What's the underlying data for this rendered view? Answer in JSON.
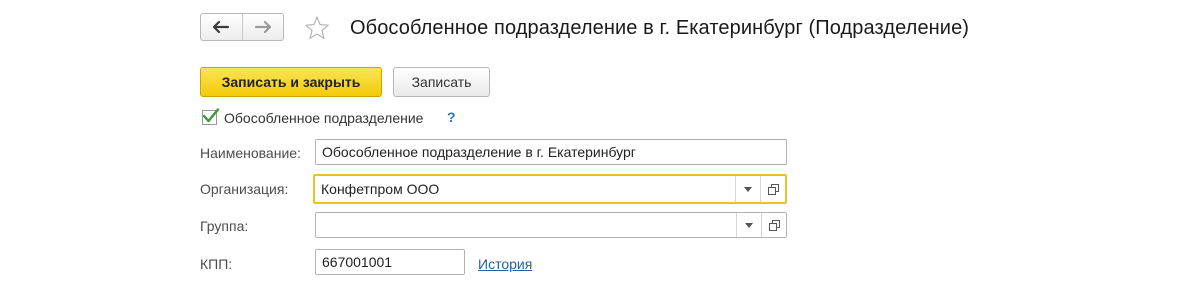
{
  "header": {
    "title": "Обособленное подразделение в г. Екатеринбург (Подразделение)",
    "back_icon": "arrow-left-icon",
    "forward_icon": "arrow-right-icon",
    "favorite_icon": "star-outline-icon"
  },
  "toolbar": {
    "save_close_label": "Записать и закрыть",
    "save_label": "Записать"
  },
  "checkbox": {
    "label": "Обособленное подразделение",
    "checked": true,
    "help": "?"
  },
  "form": {
    "name_label": "Наименование:",
    "name_value": "Обособленное подразделение в г. Екатеринбург",
    "org_label": "Организация:",
    "org_value": "Конфетпром ООО",
    "group_label": "Группа:",
    "group_value": "",
    "kpp_label": "КПП:",
    "kpp_value": "667001001",
    "history_link": "История"
  },
  "colors": {
    "primary_button": "#f5d214",
    "focus_border": "#e8c22a",
    "checkmark": "#3a9a3a",
    "link": "#2a5e9c"
  }
}
